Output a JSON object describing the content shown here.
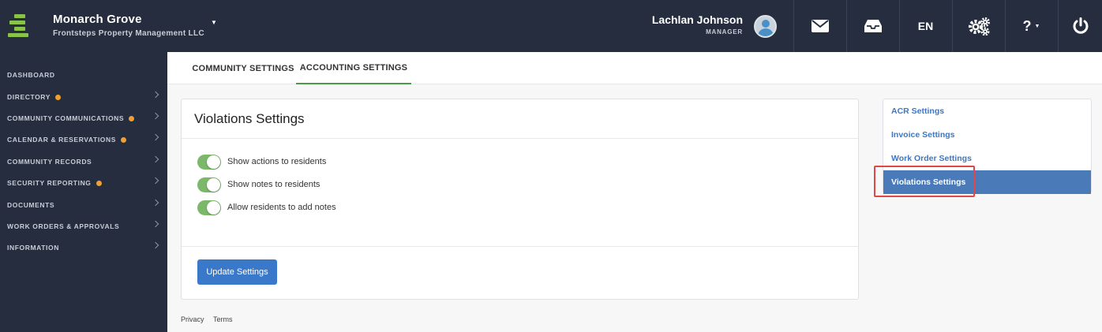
{
  "header": {
    "org_name": "Monarch Grove",
    "org_subtitle": "Frontsteps Property Management LLC",
    "user_name": "Lachlan Johnson",
    "user_role": "MANAGER",
    "language": "EN",
    "help_label": "?"
  },
  "sidebar": {
    "items": [
      {
        "label": "DASHBOARD",
        "dot": false,
        "chevron": false
      },
      {
        "label": "DIRECTORY",
        "dot": true,
        "chevron": true
      },
      {
        "label": "COMMUNITY COMMUNICATIONS",
        "dot": true,
        "chevron": true
      },
      {
        "label": "CALENDAR & RESERVATIONS",
        "dot": true,
        "chevron": true
      },
      {
        "label": "COMMUNITY RECORDS",
        "dot": false,
        "chevron": true
      },
      {
        "label": "SECURITY REPORTING",
        "dot": true,
        "chevron": true
      },
      {
        "label": "DOCUMENTS",
        "dot": false,
        "chevron": true
      },
      {
        "label": "WORK ORDERS & APPROVALS",
        "dot": false,
        "chevron": true
      },
      {
        "label": "INFORMATION",
        "dot": false,
        "chevron": true
      }
    ]
  },
  "tabs": [
    {
      "label": "COMMUNITY SETTINGS",
      "active": false
    },
    {
      "label": "ACCOUNTING SETTINGS",
      "active": true
    }
  ],
  "main": {
    "title": "Violations Settings",
    "toggles": [
      {
        "label": "Show actions to residents",
        "on": true
      },
      {
        "label": "Show notes to residents",
        "on": true
      },
      {
        "label": "Allow residents to add notes",
        "on": true
      }
    ],
    "update_button": "Update Settings"
  },
  "settings_nav": [
    {
      "label": "ACR Settings",
      "active": false
    },
    {
      "label": "Invoice Settings",
      "active": false
    },
    {
      "label": "Work Order Settings",
      "active": false
    },
    {
      "label": "Violations Settings",
      "active": true
    }
  ],
  "footer": {
    "privacy": "Privacy",
    "terms": "Terms"
  },
  "colors": {
    "topbar": "#252d3f",
    "accent_green": "#7cb86a",
    "link_blue": "#3a78c9",
    "active_nav": "#4a7bb8",
    "notification_dot": "#f0a030",
    "highlight_red": "#e04848"
  }
}
